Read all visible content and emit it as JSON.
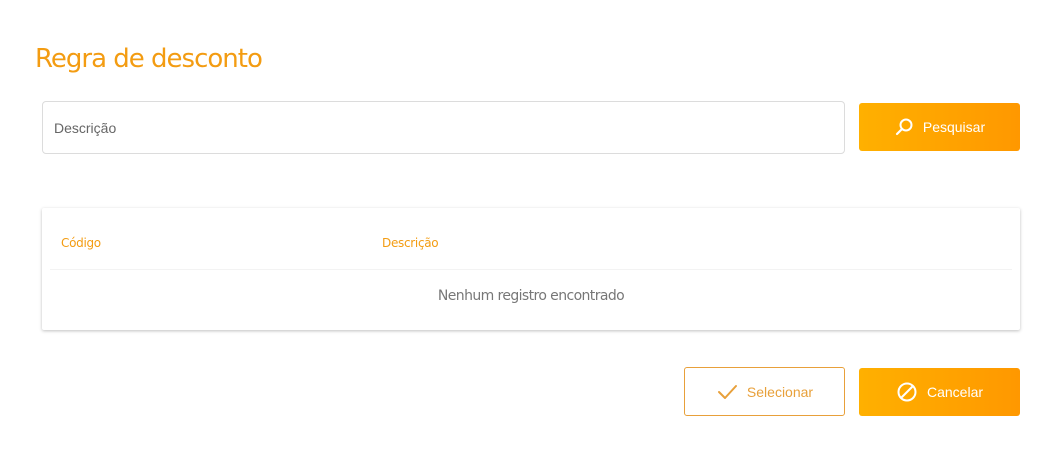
{
  "dialog": {
    "title": "Regra de desconto"
  },
  "search": {
    "placeholder": "Descrição",
    "button_label": "Pesquisar",
    "button_icon": "search-icon"
  },
  "table": {
    "columns": [
      "Código",
      "Descrição"
    ],
    "empty_message": "Nenhum registro encontrado"
  },
  "actions": {
    "select_label": "Selecionar",
    "select_icon": "check-icon",
    "cancel_label": "Cancelar",
    "cancel_icon": "cancel-icon"
  },
  "colors": {
    "accent": "#f39c12",
    "button_gradient_start": "#ffb000",
    "button_gradient_end": "#ff9800"
  }
}
